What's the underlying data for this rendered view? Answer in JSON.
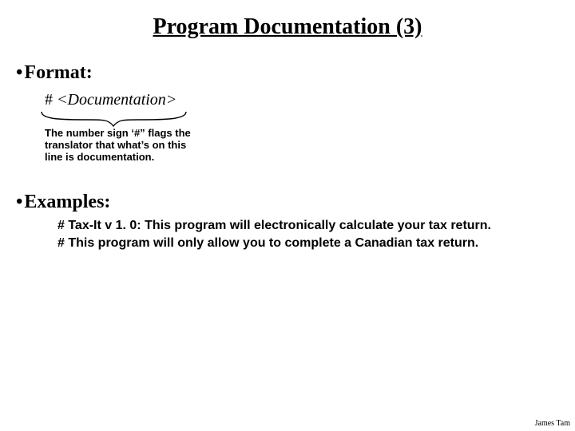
{
  "title": "Program Documentation (3)",
  "bullets": {
    "format_label": "Format:",
    "examples_label": "Examples:"
  },
  "code": {
    "hash": "#",
    "doc": "<Documentation>"
  },
  "callout": "The number sign ‘#” flags the translator that what’s on this line is documentation.",
  "examples": {
    "line1": "# Tax-It v 1. 0: This program will electronically calculate your tax return.",
    "line2": "# This program will only allow you to complete a Canadian tax return."
  },
  "footer": "James Tam"
}
